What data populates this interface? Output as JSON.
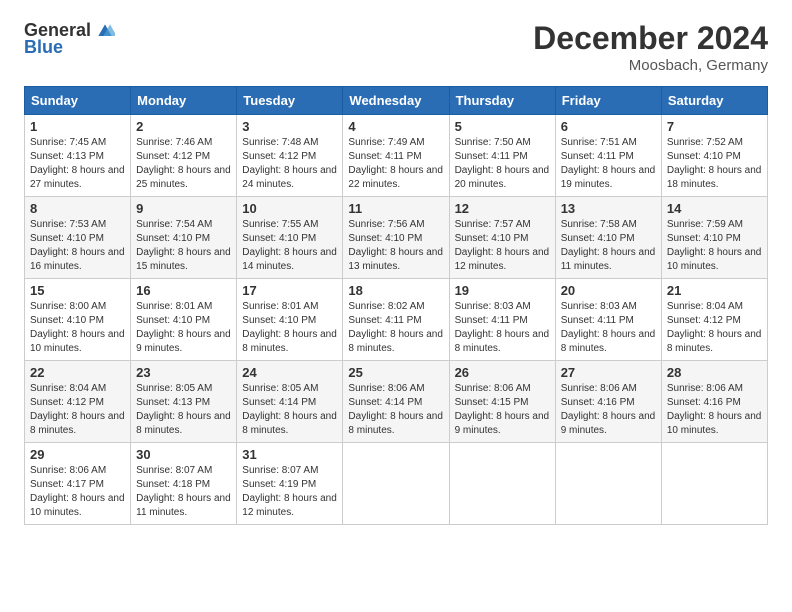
{
  "logo": {
    "general": "General",
    "blue": "Blue"
  },
  "title": "December 2024",
  "location": "Moosbach, Germany",
  "days_header": [
    "Sunday",
    "Monday",
    "Tuesday",
    "Wednesday",
    "Thursday",
    "Friday",
    "Saturday"
  ],
  "weeks": [
    [
      {
        "day": "1",
        "sunrise": "7:45 AM",
        "sunset": "4:13 PM",
        "daylight": "8 hours and 27 minutes."
      },
      {
        "day": "2",
        "sunrise": "7:46 AM",
        "sunset": "4:12 PM",
        "daylight": "8 hours and 25 minutes."
      },
      {
        "day": "3",
        "sunrise": "7:48 AM",
        "sunset": "4:12 PM",
        "daylight": "8 hours and 24 minutes."
      },
      {
        "day": "4",
        "sunrise": "7:49 AM",
        "sunset": "4:11 PM",
        "daylight": "8 hours and 22 minutes."
      },
      {
        "day": "5",
        "sunrise": "7:50 AM",
        "sunset": "4:11 PM",
        "daylight": "8 hours and 20 minutes."
      },
      {
        "day": "6",
        "sunrise": "7:51 AM",
        "sunset": "4:11 PM",
        "daylight": "8 hours and 19 minutes."
      },
      {
        "day": "7",
        "sunrise": "7:52 AM",
        "sunset": "4:10 PM",
        "daylight": "8 hours and 18 minutes."
      }
    ],
    [
      {
        "day": "8",
        "sunrise": "7:53 AM",
        "sunset": "4:10 PM",
        "daylight": "8 hours and 16 minutes."
      },
      {
        "day": "9",
        "sunrise": "7:54 AM",
        "sunset": "4:10 PM",
        "daylight": "8 hours and 15 minutes."
      },
      {
        "day": "10",
        "sunrise": "7:55 AM",
        "sunset": "4:10 PM",
        "daylight": "8 hours and 14 minutes."
      },
      {
        "day": "11",
        "sunrise": "7:56 AM",
        "sunset": "4:10 PM",
        "daylight": "8 hours and 13 minutes."
      },
      {
        "day": "12",
        "sunrise": "7:57 AM",
        "sunset": "4:10 PM",
        "daylight": "8 hours and 12 minutes."
      },
      {
        "day": "13",
        "sunrise": "7:58 AM",
        "sunset": "4:10 PM",
        "daylight": "8 hours and 11 minutes."
      },
      {
        "day": "14",
        "sunrise": "7:59 AM",
        "sunset": "4:10 PM",
        "daylight": "8 hours and 10 minutes."
      }
    ],
    [
      {
        "day": "15",
        "sunrise": "8:00 AM",
        "sunset": "4:10 PM",
        "daylight": "8 hours and 10 minutes."
      },
      {
        "day": "16",
        "sunrise": "8:01 AM",
        "sunset": "4:10 PM",
        "daylight": "8 hours and 9 minutes."
      },
      {
        "day": "17",
        "sunrise": "8:01 AM",
        "sunset": "4:10 PM",
        "daylight": "8 hours and 8 minutes."
      },
      {
        "day": "18",
        "sunrise": "8:02 AM",
        "sunset": "4:11 PM",
        "daylight": "8 hours and 8 minutes."
      },
      {
        "day": "19",
        "sunrise": "8:03 AM",
        "sunset": "4:11 PM",
        "daylight": "8 hours and 8 minutes."
      },
      {
        "day": "20",
        "sunrise": "8:03 AM",
        "sunset": "4:11 PM",
        "daylight": "8 hours and 8 minutes."
      },
      {
        "day": "21",
        "sunrise": "8:04 AM",
        "sunset": "4:12 PM",
        "daylight": "8 hours and 8 minutes."
      }
    ],
    [
      {
        "day": "22",
        "sunrise": "8:04 AM",
        "sunset": "4:12 PM",
        "daylight": "8 hours and 8 minutes."
      },
      {
        "day": "23",
        "sunrise": "8:05 AM",
        "sunset": "4:13 PM",
        "daylight": "8 hours and 8 minutes."
      },
      {
        "day": "24",
        "sunrise": "8:05 AM",
        "sunset": "4:14 PM",
        "daylight": "8 hours and 8 minutes."
      },
      {
        "day": "25",
        "sunrise": "8:06 AM",
        "sunset": "4:14 PM",
        "daylight": "8 hours and 8 minutes."
      },
      {
        "day": "26",
        "sunrise": "8:06 AM",
        "sunset": "4:15 PM",
        "daylight": "8 hours and 9 minutes."
      },
      {
        "day": "27",
        "sunrise": "8:06 AM",
        "sunset": "4:16 PM",
        "daylight": "8 hours and 9 minutes."
      },
      {
        "day": "28",
        "sunrise": "8:06 AM",
        "sunset": "4:16 PM",
        "daylight": "8 hours and 10 minutes."
      }
    ],
    [
      {
        "day": "29",
        "sunrise": "8:06 AM",
        "sunset": "4:17 PM",
        "daylight": "8 hours and 10 minutes."
      },
      {
        "day": "30",
        "sunrise": "8:07 AM",
        "sunset": "4:18 PM",
        "daylight": "8 hours and 11 minutes."
      },
      {
        "day": "31",
        "sunrise": "8:07 AM",
        "sunset": "4:19 PM",
        "daylight": "8 hours and 12 minutes."
      },
      null,
      null,
      null,
      null
    ]
  ]
}
